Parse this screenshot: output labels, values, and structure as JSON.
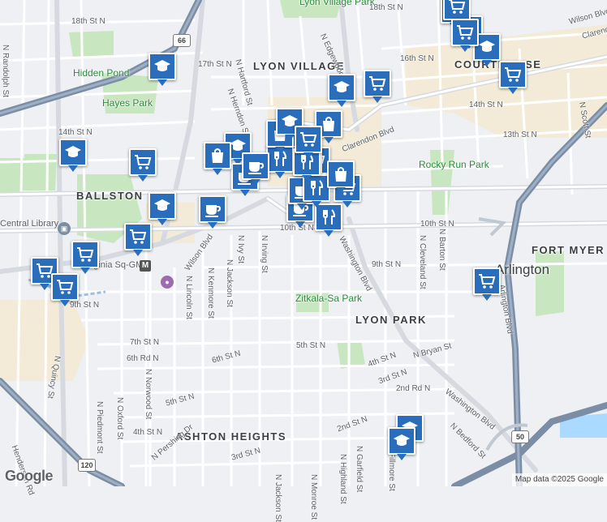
{
  "map": {
    "attribution": "Map data ©2025 Google",
    "logo": "Google",
    "colors": {
      "water": "#aadaff",
      "park": "#c8e6c0",
      "highway": "#7b8ea6",
      "arterial": "#dfe3e8",
      "street": "#ffffff",
      "commercial": "#f6ecd2",
      "marker": "#2a6ebb"
    },
    "neighborhoods": [
      "LYON VILLAGE",
      "COURTHOUSE",
      "BALLSTON",
      "FORT MYER",
      "LYON PARK",
      "ASHTON HEIGHTS"
    ],
    "city": "Arlington",
    "parks": [
      "Lyon Village Park",
      "Hidden Pond",
      "Hayes Park",
      "Rocky Run Park",
      "Zitkala-Sa Park"
    ],
    "places": {
      "library": "Central Library",
      "metro": "Virginia Sq-GMU"
    },
    "shields": [
      "66",
      "50",
      "120"
    ],
    "streets": [
      "18th St N",
      "18th St N",
      "N Edgewood St",
      "16th St N",
      "Wilson Blvd",
      "Clarendon Blvd",
      "17th St N",
      "N Hartford St",
      "N Herndon St",
      "N Randolph St",
      "14th St N",
      "14th St N",
      "13th St N",
      "N Scott St",
      "Clarendon Blvd",
      "Washington Blvd",
      "Wilson Blvd",
      "10th St N",
      "10th St N",
      "N Ivy St",
      "N Irving St",
      "N Jackson St",
      "N Kenmore St",
      "N Lincoln St",
      "N Cleveland St",
      "N Barton St",
      "9th St N",
      "9th St N",
      "Arlington Blvd",
      "Washington Blvd",
      "7th St N",
      "6th Rd N",
      "6th St N",
      "5th St N",
      "5th St N",
      "4th St N",
      "4th St N",
      "3rd St N",
      "N Bryan St",
      "2nd Rd N",
      "3rd St N",
      "2nd St N",
      "N Quincy St",
      "N Oxford St",
      "N Norwood St",
      "N Piedmont St",
      "N Pershing Dr",
      "Henderson Rd",
      "N Garfield St",
      "N Highland St",
      "N Fillmore St",
      "N Bedford St",
      "N Jackson St",
      "N Monroe St"
    ],
    "markers": [
      {
        "kind": "school"
      },
      {
        "kind": "school"
      },
      {
        "kind": "school"
      },
      {
        "kind": "school"
      },
      {
        "kind": "school"
      },
      {
        "kind": "school"
      },
      {
        "kind": "school"
      },
      {
        "kind": "school"
      },
      {
        "kind": "school"
      },
      {
        "kind": "school"
      },
      {
        "kind": "shopping-cart"
      },
      {
        "kind": "shopping-cart"
      },
      {
        "kind": "shopping-cart"
      },
      {
        "kind": "shopping-cart"
      },
      {
        "kind": "shopping-cart"
      },
      {
        "kind": "shopping-cart"
      },
      {
        "kind": "shopping-cart"
      },
      {
        "kind": "shopping-cart"
      },
      {
        "kind": "shopping-cart"
      },
      {
        "kind": "shopping-cart"
      },
      {
        "kind": "shopping-cart"
      },
      {
        "kind": "shopping-cart"
      },
      {
        "kind": "shopping-cart"
      },
      {
        "kind": "shopping-cart"
      },
      {
        "kind": "coffee-cup"
      },
      {
        "kind": "coffee-cup"
      },
      {
        "kind": "coffee-cup"
      },
      {
        "kind": "coffee-cup"
      },
      {
        "kind": "restaurant"
      },
      {
        "kind": "restaurant"
      },
      {
        "kind": "restaurant"
      },
      {
        "kind": "restaurant"
      },
      {
        "kind": "shopping-bag"
      },
      {
        "kind": "shopping-bag"
      },
      {
        "kind": "shopping-bag"
      },
      {
        "kind": "shopping-bag"
      },
      {
        "kind": "school"
      },
      {
        "kind": "restaurant"
      },
      {
        "kind": "shopping-cart"
      },
      {
        "kind": "coffee-cup"
      }
    ]
  }
}
